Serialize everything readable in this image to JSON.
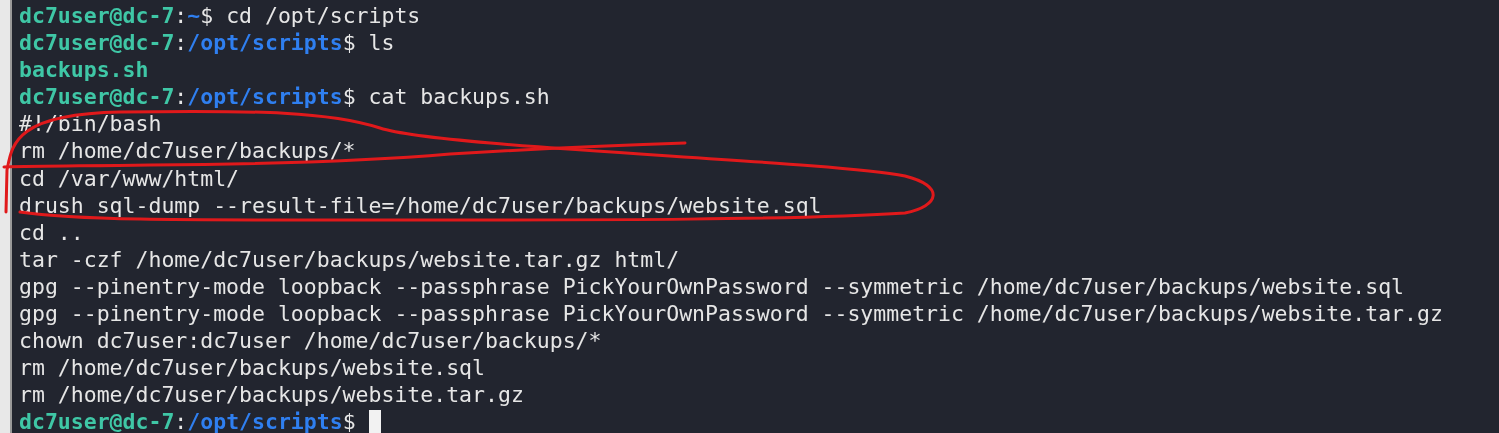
{
  "terminal": {
    "lines": [
      {
        "kind": "prompt",
        "user_host": "dc7user@dc-7",
        "separator": ":",
        "path": "~",
        "symbol": "$",
        "command": "cd /opt/scripts",
        "cursor": false
      },
      {
        "kind": "prompt",
        "user_host": "dc7user@dc-7",
        "separator": ":",
        "path": "/opt/scripts",
        "symbol": "$",
        "command": "ls",
        "cursor": false
      },
      {
        "kind": "file",
        "text": "backups.sh"
      },
      {
        "kind": "prompt",
        "user_host": "dc7user@dc-7",
        "separator": ":",
        "path": "/opt/scripts",
        "symbol": "$",
        "command": "cat backups.sh",
        "cursor": false
      },
      {
        "kind": "output",
        "text": "#!/bin/bash"
      },
      {
        "kind": "output",
        "text": "rm /home/dc7user/backups/*"
      },
      {
        "kind": "output",
        "text": "cd /var/www/html/"
      },
      {
        "kind": "output",
        "text": "drush sql-dump --result-file=/home/dc7user/backups/website.sql"
      },
      {
        "kind": "output",
        "text": "cd .."
      },
      {
        "kind": "output",
        "text": "tar -czf /home/dc7user/backups/website.tar.gz html/"
      },
      {
        "kind": "output",
        "text": "gpg --pinentry-mode loopback --passphrase PickYourOwnPassword --symmetric /home/dc7user/backups/website.sql"
      },
      {
        "kind": "output",
        "text": "gpg --pinentry-mode loopback --passphrase PickYourOwnPassword --symmetric /home/dc7user/backups/website.tar.gz"
      },
      {
        "kind": "output",
        "text": "chown dc7user:dc7user /home/dc7user/backups/*"
      },
      {
        "kind": "output",
        "text": "rm /home/dc7user/backups/website.sql"
      },
      {
        "kind": "output",
        "text": "rm /home/dc7user/backups/website.tar.gz"
      },
      {
        "kind": "prompt",
        "user_host": "dc7user@dc-7",
        "separator": ":",
        "path": "/opt/scripts",
        "symbol": "$",
        "cursor": true
      }
    ]
  }
}
